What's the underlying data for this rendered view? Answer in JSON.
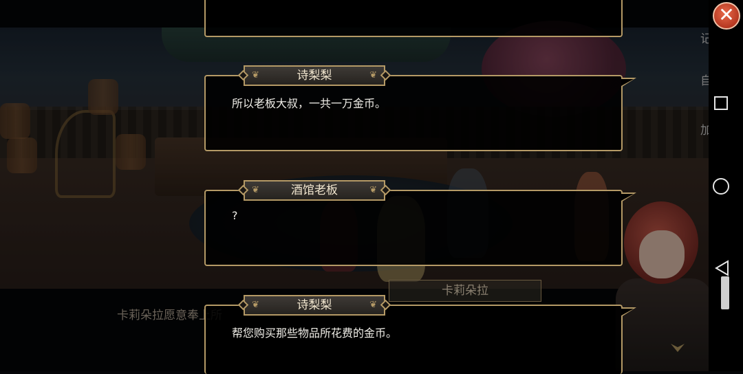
{
  "dialog_log": [
    {
      "speaker": "",
      "text": ""
    },
    {
      "speaker": "诗梨梨",
      "text": "所以老板大叔，一共一万金币。"
    },
    {
      "speaker": "酒馆老板",
      "text": "?"
    },
    {
      "speaker": "诗梨梨",
      "text": "帮您购买那些物品所花费的金币。"
    }
  ],
  "current_dialog": {
    "speaker": "卡莉朵拉",
    "text": "卡莉朵拉愿意奉上所"
  },
  "side_menu": {
    "log_label": "记录",
    "auto_label": "自动",
    "speed_label": "加速"
  },
  "colors": {
    "frame_gold": "#b59a66",
    "close_red": "#d2472a",
    "nameplate_text": "#f1e6cf"
  },
  "icons": {
    "close": "close-icon",
    "log": "record-icon",
    "nav_recent": "square-icon",
    "nav_home": "circle-icon",
    "nav_back": "triangle-back-icon"
  }
}
